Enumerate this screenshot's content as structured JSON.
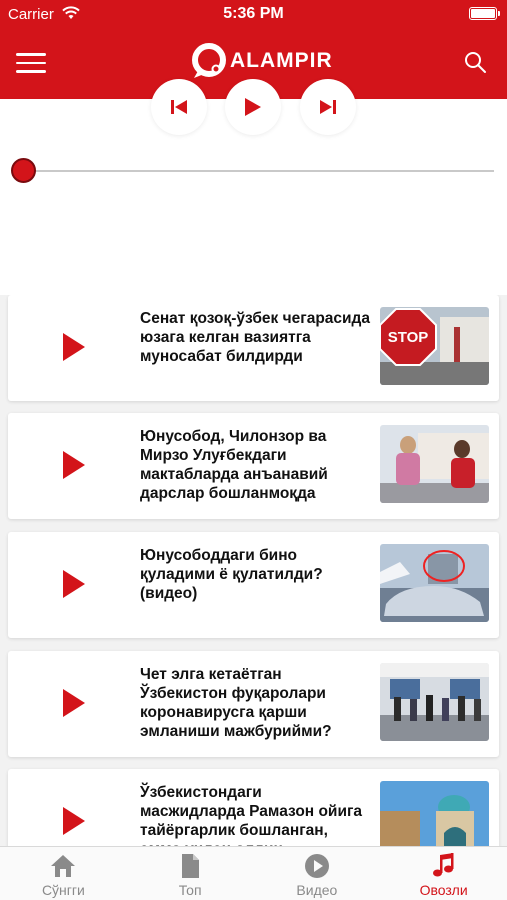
{
  "status_bar": {
    "carrier": "Carrier",
    "time": "5:36 PM"
  },
  "app": {
    "logo_text": "ALAMPIR",
    "accent": "#d3141a"
  },
  "header": {
    "menu_icon": "hamburger-icon",
    "search_icon": "search-icon"
  },
  "player": {
    "controls": [
      "previous-icon",
      "play-icon",
      "next-icon"
    ],
    "progress": 0
  },
  "items": [
    {
      "title": "Сенат қозоқ-ўзбек чегарасида юзага келган вазиятга муносабат билдирди",
      "thumb": "stop-sign"
    },
    {
      "title": "Юнусобод, Чилонзор ва Мирзо Улуғбекдаги мактабларда анъанавий дарслар бошланмоқда",
      "thumb": "schoolchildren"
    },
    {
      "title": "Юнусободдаги бино қуладими ё қулатилди? (видео)",
      "thumb": "building-car"
    },
    {
      "title": "Чет элга кетаётган Ўзбекистон фуқаролари коронавирусга қарши эмланиши мажбурийми?",
      "thumb": "airport-crowd"
    },
    {
      "title": "Ўзбекистондаги масжидларда Рамазон ойига тайёргарлик бошланган, аммо ундан олдин...",
      "thumb": "mosque"
    }
  ],
  "tabs": [
    {
      "label": "Сўнгги",
      "icon": "home-icon",
      "active": false
    },
    {
      "label": "Топ",
      "icon": "document-icon",
      "active": false
    },
    {
      "label": "Видео",
      "icon": "play-circle-icon",
      "active": false
    },
    {
      "label": "Овозли",
      "icon": "music-note-icon",
      "active": true
    }
  ]
}
